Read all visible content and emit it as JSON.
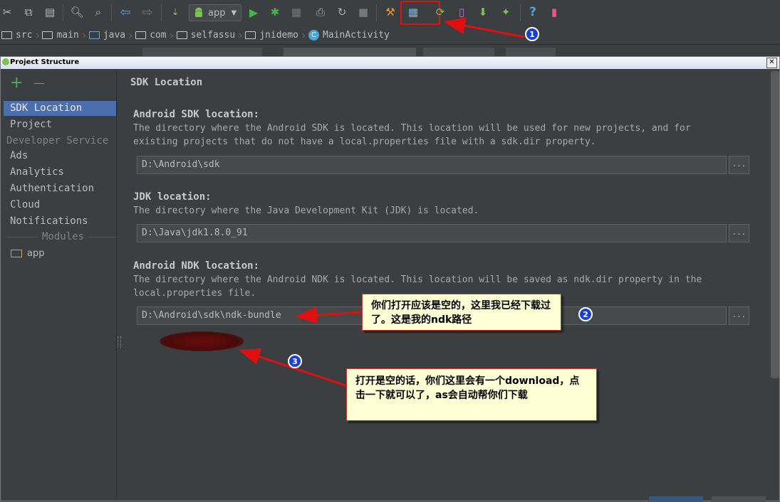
{
  "toolbar": {
    "run_config": "app"
  },
  "breadcrumb": [
    "src",
    "main",
    "java",
    "com",
    "selfassu",
    "jnidemo",
    "MainActivity"
  ],
  "dialog": {
    "title": "Project Structure",
    "close_glyph": "✕",
    "sidebar": {
      "add_glyph": "+",
      "remove_glyph": "—",
      "items_top": [
        "SDK Location",
        "Project"
      ],
      "group_developer": "Developer Service",
      "items_dev": [
        "Ads",
        "Analytics",
        "Authentication",
        "Cloud",
        "Notifications"
      ],
      "group_modules": "Modules",
      "module_app": "app"
    },
    "content": {
      "header": "SDK Location",
      "android_sdk": {
        "title": "Android SDK location:",
        "desc": "The directory where the Android SDK is located. This location will be used for new projects, and for existing projects that do not have a local.properties file with a sdk.dir property.",
        "value": "D:\\Android\\sdk"
      },
      "jdk": {
        "title": "JDK location:",
        "desc": "The directory where the Java Development Kit (JDK) is located.",
        "value": "D:\\Java\\jdk1.8.0_91"
      },
      "ndk": {
        "title": "Android NDK location:",
        "desc": "The directory where the Android NDK is located. This location will be saved as ndk.dir property in the local.properties file.",
        "value": "D:\\Android\\sdk\\ndk-bundle"
      },
      "browse_glyph": "..."
    }
  },
  "annotations": {
    "badge1": "1",
    "badge2": "2",
    "badge3": "3",
    "callout2": "你们打开应该是空的，这里我已经下载过了。这是我的ndk路径",
    "callout3": "打开是空的话，你们这里会有一个download，点击一下就可以了，as会自动帮你们下载"
  },
  "colors": {
    "background": "#3c3f41",
    "selection": "#4b6eaf",
    "annotation_red": "#e01010",
    "callout_fill": "#ffffd6",
    "badge_blue": "#1a3fd6",
    "android_green": "#78c257"
  }
}
